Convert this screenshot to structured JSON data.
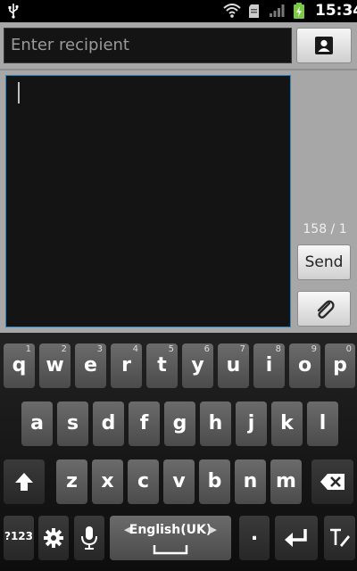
{
  "status_bar": {
    "time": "15:34",
    "icons": [
      "usb-icon",
      "wifi-icon",
      "sd-card-icon",
      "signal-icon",
      "battery-charging-icon"
    ]
  },
  "compose": {
    "recipient_placeholder": "Enter recipient",
    "char_counter": "158 / 1",
    "send_label": "Send",
    "message_text": "",
    "icons": {
      "contact": "contact-icon",
      "attach": "paperclip-icon"
    },
    "colors": {
      "background": "#a7a7a7",
      "field": "#141414",
      "focus_border": "#2a89c8"
    }
  },
  "keyboard": {
    "row1": [
      {
        "key": "q",
        "hint": "1"
      },
      {
        "key": "w",
        "hint": "2"
      },
      {
        "key": "e",
        "hint": "3"
      },
      {
        "key": "r",
        "hint": "4"
      },
      {
        "key": "t",
        "hint": "5"
      },
      {
        "key": "y",
        "hint": "6"
      },
      {
        "key": "u",
        "hint": "7"
      },
      {
        "key": "i",
        "hint": "8"
      },
      {
        "key": "o",
        "hint": "9"
      },
      {
        "key": "p",
        "hint": "0"
      }
    ],
    "row2": [
      "a",
      "s",
      "d",
      "f",
      "g",
      "h",
      "j",
      "k",
      "l"
    ],
    "row3": [
      "z",
      "x",
      "c",
      "v",
      "b",
      "n",
      "m"
    ],
    "symbols_label": "?123",
    "language_label": "English(UK)",
    "period_label": ".",
    "special_icons": [
      "shift-icon",
      "backspace-icon",
      "settings-icon",
      "microphone-icon",
      "enter-icon",
      "handwriting-icon"
    ]
  }
}
